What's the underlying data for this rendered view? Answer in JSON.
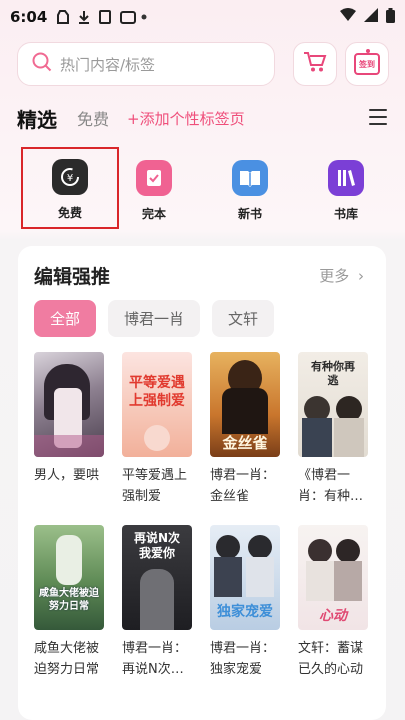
{
  "status_bar": {
    "time": "6:04"
  },
  "search": {
    "placeholder": "热门内容/标签",
    "sign_label": "签到"
  },
  "tabs": {
    "selected": "精选",
    "free": "免费",
    "add_tag": "+添加个性标签页"
  },
  "quick_entries": [
    {
      "label": "免费",
      "icon": "yen-clock-icon",
      "color": "#2b2b2b"
    },
    {
      "label": "完本",
      "icon": "check-book-icon",
      "color": "#f06292"
    },
    {
      "label": "新书",
      "icon": "open-book-icon",
      "color": "#4a90e2"
    },
    {
      "label": "书库",
      "icon": "library-icon",
      "color": "#7b3fd6"
    }
  ],
  "editor_picks": {
    "title": "编辑强推",
    "more": "更多",
    "chips": [
      "全部",
      "博君一肖",
      "文轩"
    ],
    "books": [
      {
        "title": "男人，要哄",
        "cover_text": ""
      },
      {
        "title": "平等爱遇上强制爱",
        "cover_text": "平等爱遇上强制爱"
      },
      {
        "title": "博君一肖：金丝雀",
        "cover_text": "金丝雀"
      },
      {
        "title": "《博君一肖：有种…",
        "cover_text": "有种你再逃"
      },
      {
        "title": "咸鱼大佬被迫努力日常",
        "cover_text": "咸鱼大佬被迫努力日常"
      },
      {
        "title": "博君一肖：再说N次…",
        "cover_text": "再说N次我爱你"
      },
      {
        "title": "博君一肖：独家宠爱",
        "cover_text": "独家宠爱"
      },
      {
        "title": "文轩：蓄谋已久的心动",
        "cover_text": "心动"
      }
    ]
  }
}
